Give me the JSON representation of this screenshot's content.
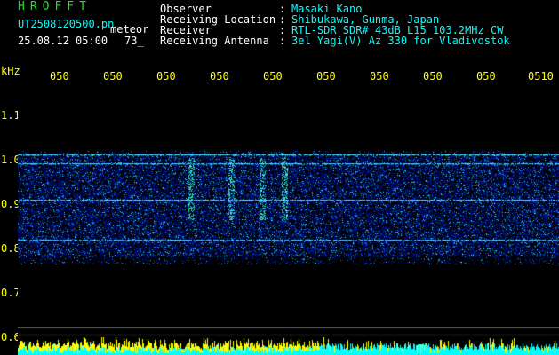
{
  "header": {
    "app_title": "HROFFT",
    "filename": "UT2508120500.pn",
    "station_type": "meteor",
    "datetime": "25.08.12 05:00",
    "count": "73_"
  },
  "info": [
    {
      "label": "Observer",
      "value": "Masaki Kano"
    },
    {
      "label": "Receiving Location",
      "value": "Shibukawa, Gunma, Japan"
    },
    {
      "label": "Receiver",
      "value": "RTL-SDR SDR# 43dB L15 103.2MHz CW"
    },
    {
      "label": "Receiving Antenna",
      "value": "3el Yagi(V) Az 330 for Vladivostok"
    }
  ],
  "separator": ":",
  "y_axis": {
    "unit": "kHz",
    "ticks": [
      "1.1",
      "1.0",
      "0.9",
      "0.8",
      "0.7",
      "0.6"
    ]
  },
  "x_axis": {
    "ticks": [
      "050",
      "050",
      "050",
      "050",
      "050",
      "050",
      "050",
      "050",
      "050",
      "0510"
    ]
  },
  "colors": {
    "label": "#ffffff",
    "value": "#00ffff",
    "title": "#19e619",
    "tick": "#ffff00",
    "spectrum_low": "#00007a",
    "spectrum_high": "#3cffff"
  }
}
